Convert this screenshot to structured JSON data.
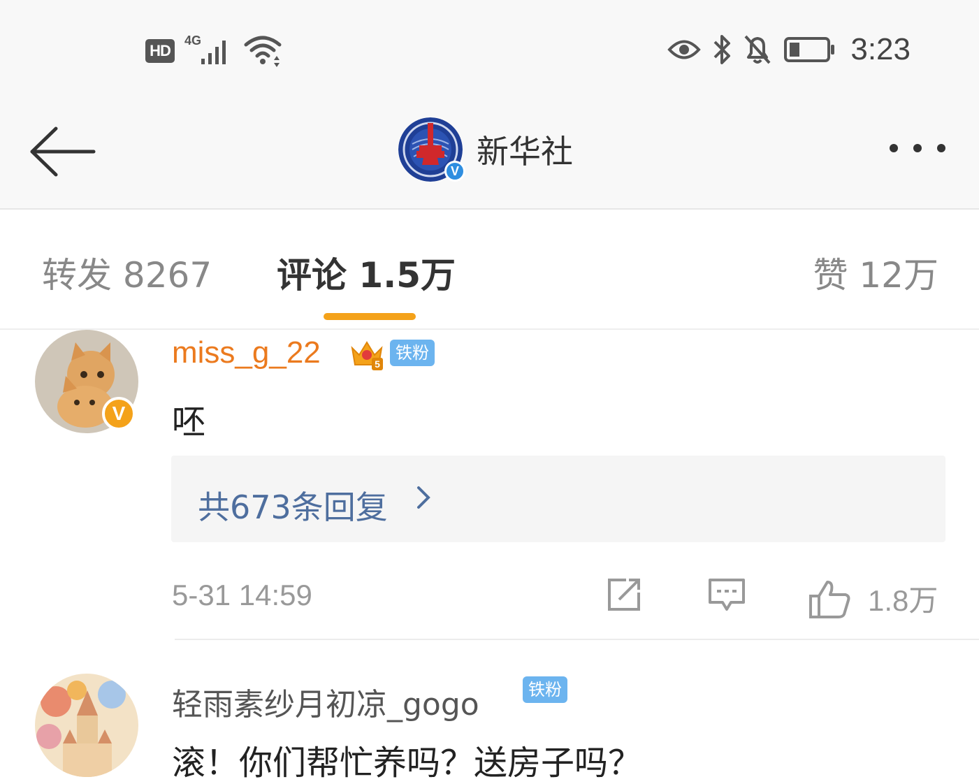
{
  "status_bar": {
    "hd_label": "HD",
    "network_label": "4G",
    "time": "3:23",
    "icons": [
      "hd-icon",
      "signal-4g-icon",
      "wifi-icon",
      "eye-icon",
      "bluetooth-icon",
      "mute-bell-icon",
      "battery-icon"
    ]
  },
  "nav": {
    "title": "新华社",
    "back_icon": "arrow-left-icon",
    "more_icon": "more-dots-icon",
    "verified_mark": "V"
  },
  "tabs": {
    "repost": "转发 8267",
    "comments": "评论 1.5万",
    "likes": "赞 12万",
    "active": "comments",
    "active_color": "#f4a21a"
  },
  "comments": [
    {
      "username": "miss_g_22",
      "username_color": "#eb7a1e",
      "badge": "铁粉",
      "crown_level": "5",
      "verified_mark": "V",
      "text": "呸",
      "replies_label": "共673条回复",
      "time": "5-31 14:59",
      "like_count": "1.8万"
    },
    {
      "username": "轻雨素纱月初凉_gogo",
      "badge": "铁粉",
      "text": "滚！你们帮忙养吗？送房子吗？"
    }
  ],
  "colors": {
    "accent": "#f4a21a",
    "link": "#4e6e9e",
    "badge_blue": "#6cb4ef",
    "verified_blue": "#2f8ee0"
  }
}
